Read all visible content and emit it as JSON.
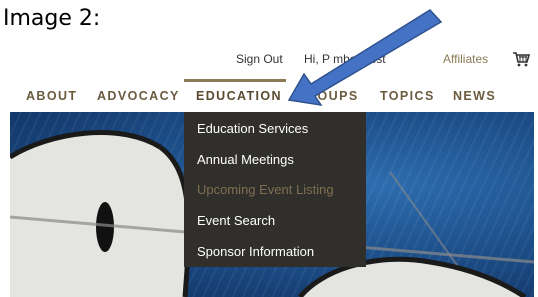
{
  "caption": "Image 2:",
  "utility": {
    "sign_out": "Sign Out",
    "greeting": "Hi, P          mber Test",
    "affiliates": "Affiliates",
    "cart_icon": "shopping-cart-icon"
  },
  "nav": {
    "items": [
      {
        "label": "ABOUT"
      },
      {
        "label": "ADVOCACY"
      },
      {
        "label": "EDUCATION",
        "active": true
      },
      {
        "label": "GROUPS"
      },
      {
        "label": "TOPICS"
      },
      {
        "label": "NEWS"
      }
    ]
  },
  "dropdown": {
    "items": [
      {
        "label": "Education Services"
      },
      {
        "label": "Annual Meetings"
      },
      {
        "label": "Upcoming Event Listing",
        "disabled": true
      },
      {
        "label": "Event Search"
      },
      {
        "label": "Sponsor Information"
      }
    ]
  },
  "colors": {
    "accent": "#8c7a56",
    "dropdown_bg": "#302f2c",
    "arrow": "#4472c4"
  }
}
